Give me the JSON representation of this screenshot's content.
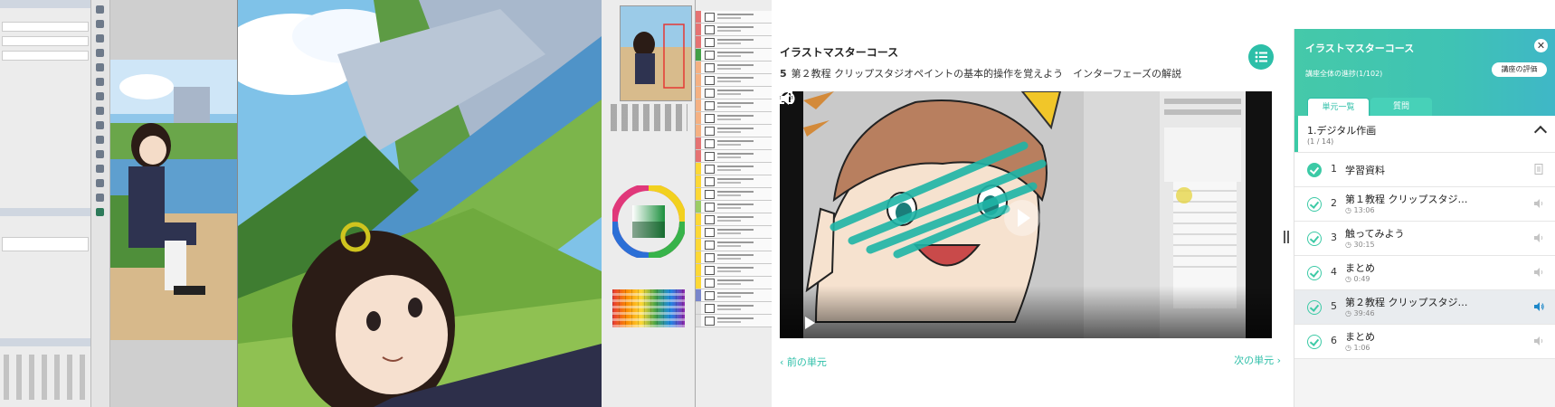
{
  "course": {
    "title": "イラストマスターコース",
    "lesson_number": "5",
    "lesson_title": "第２教程 クリップスタジオペイントの基本的操作を覚えよう　インターフェーズの解説"
  },
  "nav": {
    "prev_label": "前の単元",
    "next_label": "次の単元"
  },
  "player": {
    "state": "paused",
    "icons": [
      "play-icon",
      "volume-icon",
      "speed-icon",
      "fullscreen-icon"
    ]
  },
  "sidebar": {
    "title": "イラストマスターコース",
    "progress_text": "講座全体の進捗(1/102)",
    "rate_label": "講座の評価",
    "close_label": "✕",
    "tabs": [
      {
        "label": "単元一覧",
        "active": true
      },
      {
        "label": "質問",
        "active": false
      }
    ],
    "chapter": {
      "title": "1.デジタル作画",
      "count": "(1 / 14)"
    },
    "items": [
      {
        "number": "1",
        "title": "学習資料",
        "duration": "",
        "icon": "document-icon",
        "done": true,
        "active": false
      },
      {
        "number": "2",
        "title": "第１教程 クリップスタジ…",
        "duration": "13:06",
        "icon": "speaker-icon",
        "done": false,
        "active": false
      },
      {
        "number": "3",
        "title": "触ってみよう",
        "duration": "30:15",
        "icon": "speaker-icon",
        "done": false,
        "active": false
      },
      {
        "number": "4",
        "title": "まとめ",
        "duration": "0:49",
        "icon": "speaker-icon",
        "done": false,
        "active": false
      },
      {
        "number": "5",
        "title": "第２教程 クリップスタジ…",
        "duration": "39:46",
        "icon": "speaker-icon",
        "done": false,
        "active": true
      },
      {
        "number": "6",
        "title": "まとめ",
        "duration": "1:06",
        "icon": "speaker-icon",
        "done": false,
        "active": false
      }
    ]
  },
  "colors": {
    "accent": "#2dbfa8",
    "header_gradient_start": "#45c9a9",
    "header_gradient_end": "#3fb7c7",
    "active_speaker": "#1e88c9"
  }
}
